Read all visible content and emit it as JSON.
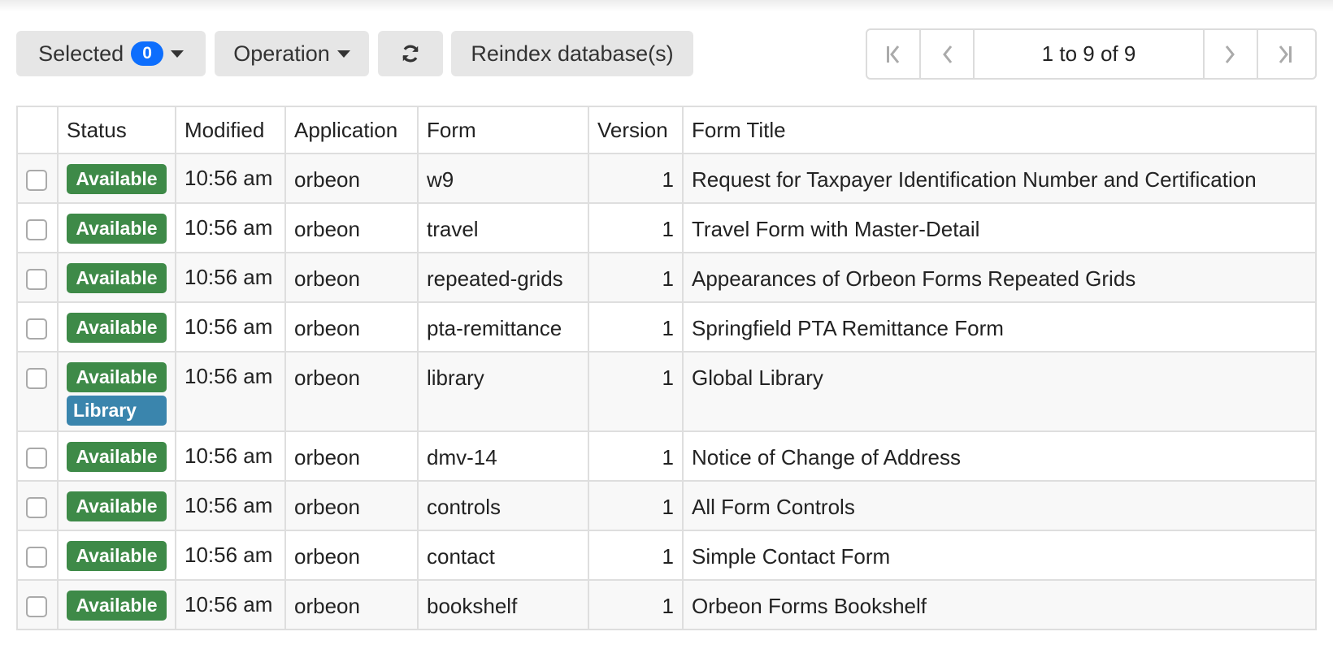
{
  "toolbar": {
    "selected_label": "Selected",
    "selected_count": "0",
    "operation_label": "Operation",
    "refresh_icon": "refresh-icon",
    "reindex_label": "Reindex database(s)"
  },
  "pager": {
    "info": "1 to 9 of 9",
    "first_icon": "first-page-icon",
    "prev_icon": "previous-page-icon",
    "next_icon": "next-page-icon",
    "last_icon": "last-page-icon"
  },
  "table": {
    "headers": {
      "status": "Status",
      "modified": "Modified",
      "application": "Application",
      "form": "Form",
      "version": "Version",
      "title": "Form Title"
    },
    "rows": [
      {
        "status": "Available",
        "modified": "10:56 am",
        "app": "orbeon",
        "form": "w9",
        "version": "1",
        "title": "Request for Taxpayer Identification Number and Certification"
      },
      {
        "status": "Available",
        "modified": "10:56 am",
        "app": "orbeon",
        "form": "travel",
        "version": "1",
        "title": "Travel Form with Master-Detail"
      },
      {
        "status": "Available",
        "modified": "10:56 am",
        "app": "orbeon",
        "form": "repeated-grids",
        "version": "1",
        "title": "Appearances of Orbeon Forms Repeated Grids"
      },
      {
        "status": "Available",
        "modified": "10:56 am",
        "app": "orbeon",
        "form": "pta-remittance",
        "version": "1",
        "title": "Springfield PTA Remittance Form"
      },
      {
        "status": "Available",
        "status2": "Library",
        "modified": "10:56 am",
        "app": "orbeon",
        "form": "library",
        "version": "1",
        "title": "Global Library"
      },
      {
        "status": "Available",
        "modified": "10:56 am",
        "app": "orbeon",
        "form": "dmv-14",
        "version": "1",
        "title": "Notice of Change of Address"
      },
      {
        "status": "Available",
        "modified": "10:56 am",
        "app": "orbeon",
        "form": "controls",
        "version": "1",
        "title": "All Form Controls"
      },
      {
        "status": "Available",
        "modified": "10:56 am",
        "app": "orbeon",
        "form": "contact",
        "version": "1",
        "title": "Simple Contact Form"
      },
      {
        "status": "Available",
        "modified": "10:56 am",
        "app": "orbeon",
        "form": "bookshelf",
        "version": "1",
        "title": "Orbeon Forms Bookshelf"
      }
    ]
  },
  "colors": {
    "available_badge": "#3e8a48",
    "library_badge": "#3a85ad",
    "count_badge": "#0d6efd",
    "button_bg": "#e6e6e6"
  }
}
